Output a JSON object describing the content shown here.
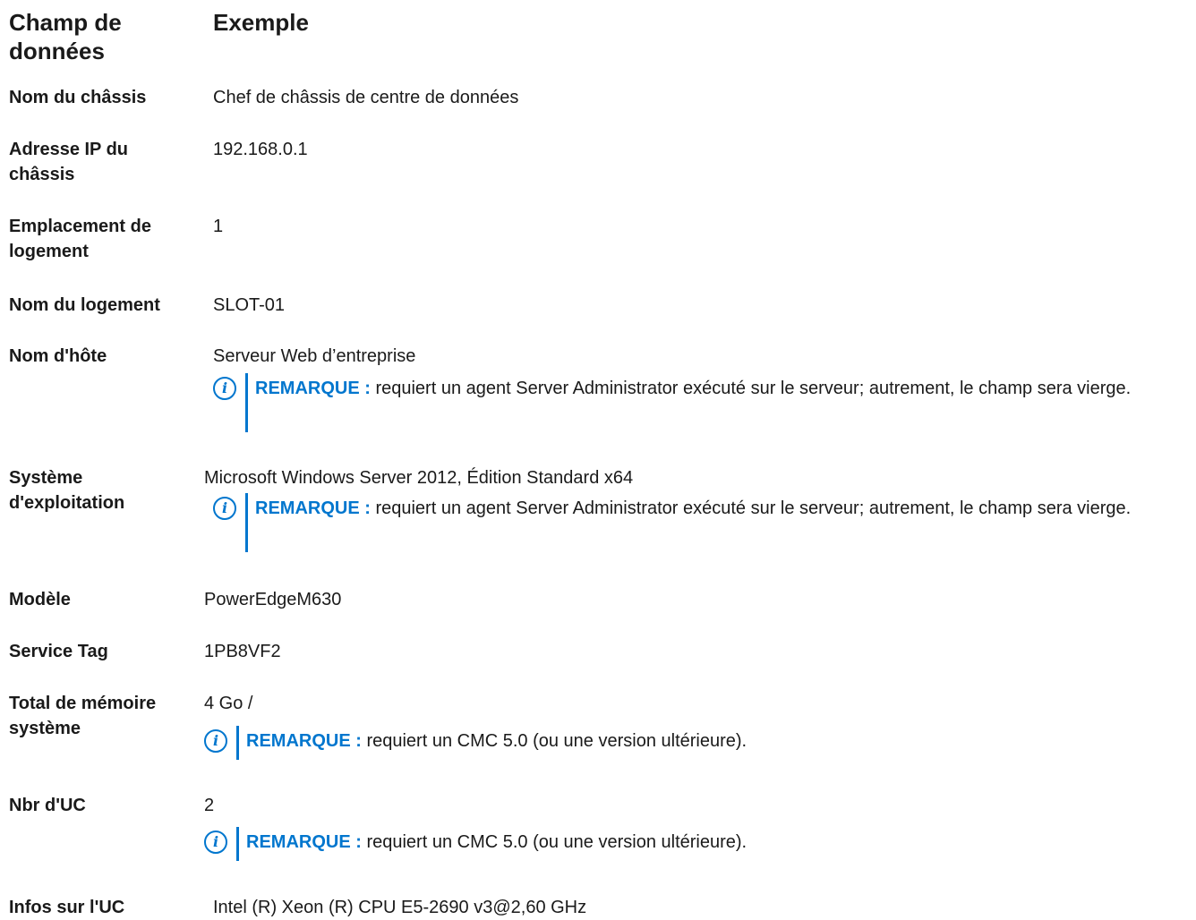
{
  "header": {
    "col1": "Champ de données",
    "col2": "Exemple"
  },
  "rows": [
    {
      "label": "Nom du châssis",
      "value": "Chef de châssis de centre de données"
    },
    {
      "label": "Adresse IP du châssis",
      "value": "192.168.0.1"
    },
    {
      "label": "Emplacement de logement",
      "value": "1"
    },
    {
      "label": "Nom du logement",
      "value": "SLOT-01"
    },
    {
      "label": "Nom d'hôte",
      "value": "Serveur Web d’entreprise",
      "note_label": "REMARQUE :",
      "note_text": "requiert un agent Server Administrator exécuté sur le serveur; autrement, le champ sera vierge."
    },
    {
      "label": "Système d'exploitation",
      "value": "Microsoft Windows Server 2012, Édition Standard x64",
      "note_label": "REMARQUE :",
      "note_text": "requiert un agent Server Administrator exécuté sur le serveur; autrement, le champ sera vierge."
    },
    {
      "label": "Modèle",
      "value": "PowerEdgeM630"
    },
    {
      "label": "Service Tag",
      "value": "1PB8VF2"
    },
    {
      "label": "Total de mémoire système",
      "value": "4 Go /",
      "note_label": "REMARQUE :",
      "note_text": "requiert un CMC 5.0 (ou une version ultérieure)."
    },
    {
      "label": "Nbr d'UC",
      "value": "2",
      "note_label": "REMARQUE :",
      "note_text": "requiert un CMC 5.0 (ou une version ultérieure)."
    },
    {
      "label": "Infos sur l'UC",
      "value": "Intel (R) Xeon (R) CPU E5-2690 v3@2,60 GHz"
    }
  ],
  "icons": {
    "note": "info-circle-icon"
  },
  "colors": {
    "accent": "#0076ce",
    "text": "#1a1a1a"
  }
}
